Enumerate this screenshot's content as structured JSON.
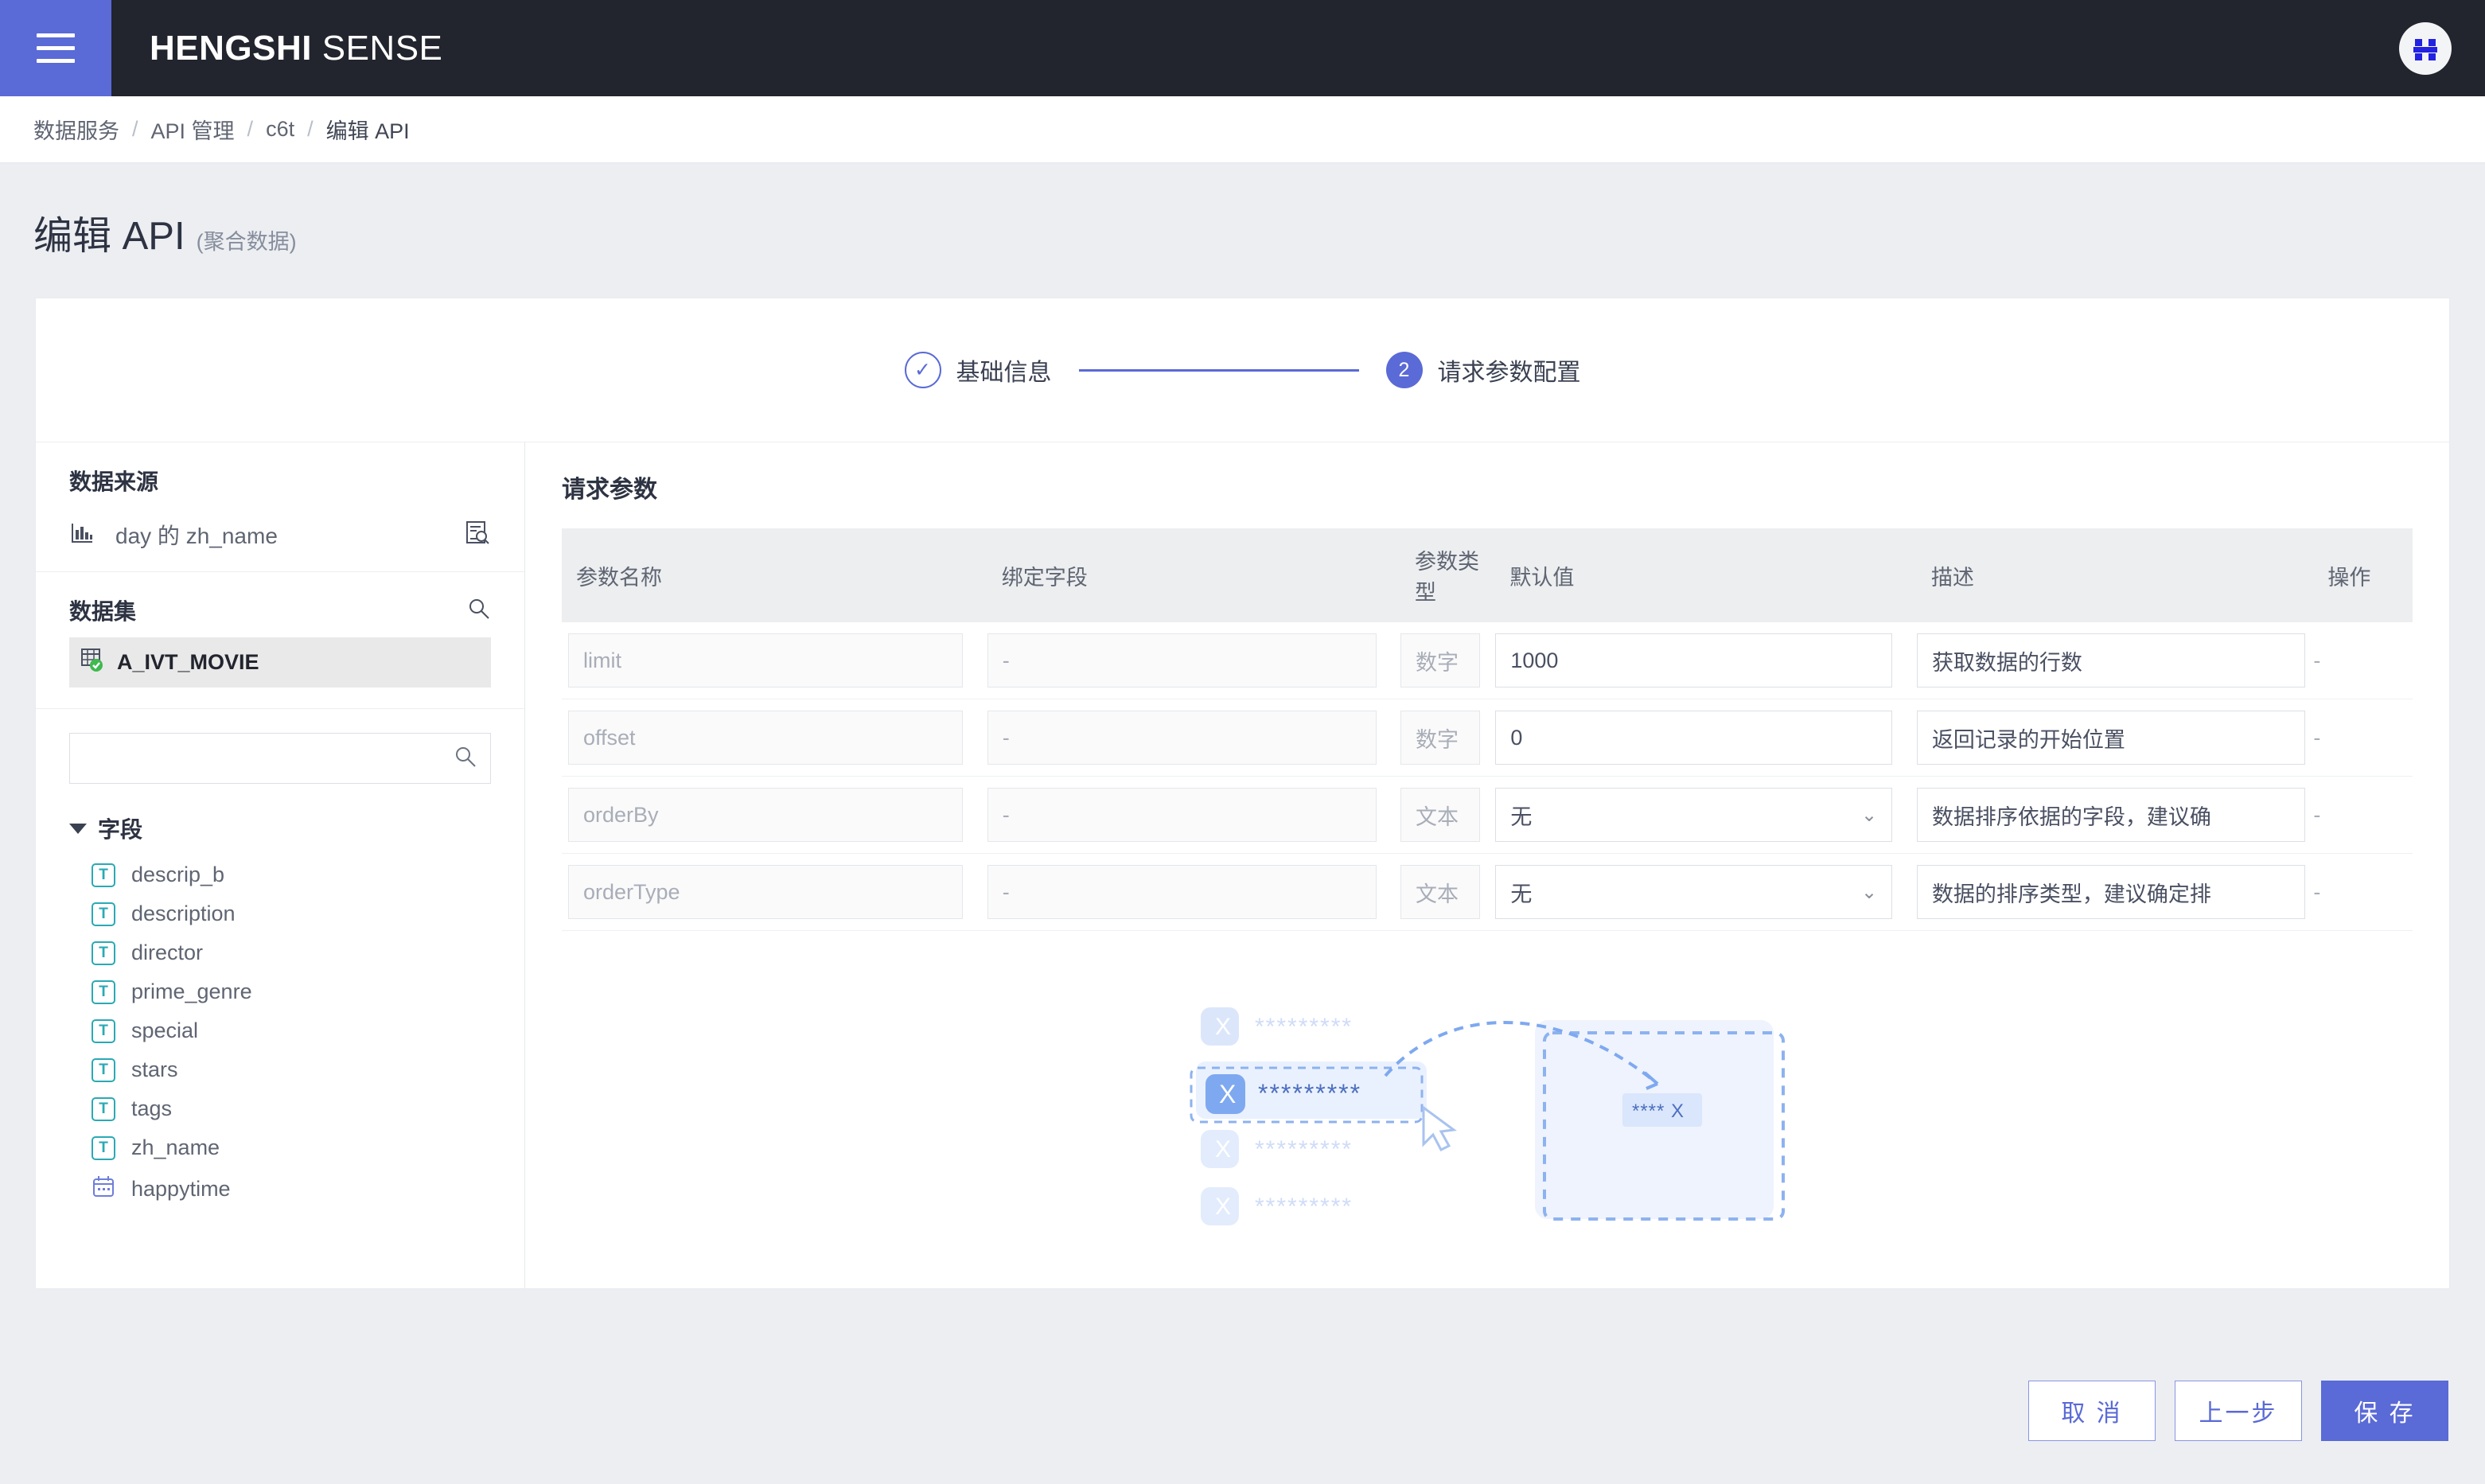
{
  "header": {
    "brand_bold": "HENGSHI",
    "brand_light": "SENSE",
    "menu_icon": "hamburger-icon",
    "avatar_icon": "user-avatar-icon"
  },
  "breadcrumb": {
    "items": [
      "数据服务",
      "API 管理",
      "c6t",
      "编辑 API"
    ],
    "separator": "/"
  },
  "page": {
    "title": "编辑 API",
    "subtitle": "(聚合数据)"
  },
  "stepper": {
    "steps": [
      {
        "marker": "✓",
        "label": "基础信息",
        "state": "done"
      },
      {
        "marker": "2",
        "label": "请求参数配置",
        "state": "active"
      }
    ]
  },
  "left_panel": {
    "source": {
      "title": "数据来源",
      "name": "day 的 zh_name",
      "chart_icon": "bar-chart-icon",
      "preview_icon": "document-search-icon"
    },
    "dataset": {
      "title": "数据集",
      "search_icon": "search-icon",
      "items": [
        {
          "name": "A_IVT_MOVIE",
          "icon": "table-check-icon",
          "selected": true
        }
      ]
    },
    "search": {
      "value": "",
      "placeholder": "",
      "icon": "search-icon"
    },
    "fields": {
      "title": "字段",
      "expanded": true,
      "items": [
        {
          "label": "descrip_b",
          "type": "text"
        },
        {
          "label": "description",
          "type": "text"
        },
        {
          "label": "director",
          "type": "text"
        },
        {
          "label": "prime_genre",
          "type": "text"
        },
        {
          "label": "special",
          "type": "text"
        },
        {
          "label": "stars",
          "type": "text"
        },
        {
          "label": "tags",
          "type": "text"
        },
        {
          "label": "zh_name",
          "type": "text"
        },
        {
          "label": "happytime",
          "type": "date"
        }
      ]
    }
  },
  "right_panel": {
    "title": "请求参数",
    "columns": [
      "参数名称",
      "绑定字段",
      "参数类型",
      "默认值",
      "描述",
      "操作"
    ],
    "rows": [
      {
        "name": "limit",
        "bind": "-",
        "type": "数字",
        "default_value": "1000",
        "default_kind": "input",
        "description": "获取数据的行数",
        "action": "-"
      },
      {
        "name": "offset",
        "bind": "-",
        "type": "数字",
        "default_value": "0",
        "default_kind": "input",
        "description": "返回记录的开始位置",
        "action": "-"
      },
      {
        "name": "orderBy",
        "bind": "-",
        "type": "文本",
        "default_value": "无",
        "default_kind": "select",
        "description": "数据排序依据的字段，建议确",
        "action": "-"
      },
      {
        "name": "orderType",
        "bind": "-",
        "type": "文本",
        "default_value": "无",
        "default_kind": "select",
        "description": "数据的排序类型，建议确定排",
        "action": "-"
      }
    ],
    "illustration": {
      "name": "drag-field-illustration",
      "left_items": [
        "*********",
        "*********",
        "*********",
        "*********"
      ],
      "dropped_chip": "**** X",
      "badge_letter": "X",
      "cursor_icon": "mouse-pointer-icon"
    }
  },
  "footer": {
    "cancel_label": "取 消",
    "prev_label": "上一步",
    "save_label": "保 存"
  },
  "colors": {
    "accent": "#5a6ad6",
    "topbar": "#22242e",
    "page_bg": "#eceef2",
    "table_header": "#eceef0",
    "field_type_text": "#2aa9b5",
    "dataset_check": "#3fb950"
  }
}
